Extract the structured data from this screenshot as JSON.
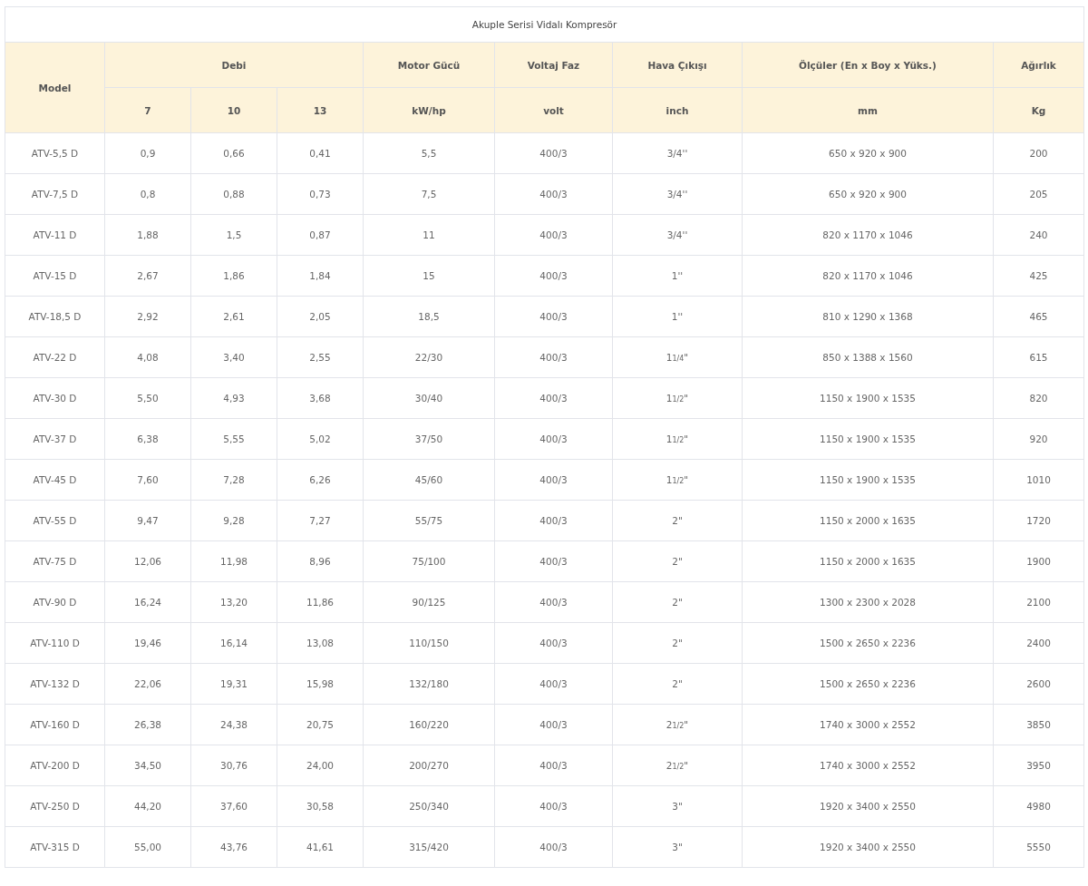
{
  "table": {
    "title": "Akuple Serisi Vidalı Kompresör",
    "header_groups": [
      {
        "label": "Model",
        "kind": "stacked"
      },
      {
        "label": "Debi",
        "kind": "group"
      },
      {
        "label": "Motor Gücü",
        "kind": "column"
      },
      {
        "label": "Voltaj Faz",
        "kind": "column"
      },
      {
        "label": "Hava Çıkışı",
        "kind": "column"
      },
      {
        "label": "Ölçüler (En x Boy x Yüks.)",
        "kind": "column"
      },
      {
        "label": "Ağırlık",
        "kind": "column"
      }
    ],
    "subheaders": [
      "7",
      "10",
      "13",
      "kW/hp",
      "volt",
      "inch",
      "mm",
      "Kg"
    ],
    "rows": [
      [
        "ATV-5,5 D",
        "0,9",
        "0,66",
        "0,41",
        "5,5",
        "400/3",
        "3/4''",
        "650 x 920 x 900",
        "200"
      ],
      [
        "ATV-7,5 D",
        "0,8",
        "0,88",
        "0,73",
        "7,5",
        "400/3",
        "3/4''",
        "650 x 920 x 900",
        "205"
      ],
      [
        "ATV-11 D",
        "1,88",
        "1,5",
        "0,87",
        "11",
        "400/3",
        "3/4''",
        "820 x 1170 x 1046",
        "240"
      ],
      [
        "ATV-15 D",
        "2,67",
        "1,86",
        "1,84",
        "15",
        "400/3",
        "1''",
        "820 x 1170 x 1046",
        "425"
      ],
      [
        "ATV-18,5 D",
        "2,92",
        "2,61",
        "2,05",
        "18,5",
        "400/3",
        "1''",
        "810 x 1290 x 1368",
        "465"
      ],
      [
        "ATV-22 D",
        "4,08",
        "3,40",
        "2,55",
        "22/30",
        "400/3",
        "1$_{1/4}$\"",
        "850 x 1388 x 1560",
        "615"
      ],
      [
        "ATV-30 D",
        "5,50",
        "4,93",
        "3,68",
        "30/40",
        "400/3",
        "1$_{1/2}$\"",
        "1150 x 1900 x 1535",
        "820"
      ],
      [
        "ATV-37 D",
        "6,38",
        "5,55",
        "5,02",
        "37/50",
        "400/3",
        "1$_{1/2}$\"",
        "1150 x 1900 x 1535",
        "920"
      ],
      [
        "ATV-45 D",
        "7,60",
        "7,28",
        "6,26",
        "45/60",
        "400/3",
        "1$_{1/2}$\"",
        "1150 x 1900 x 1535",
        "1010"
      ],
      [
        "ATV-55 D",
        "9,47",
        "9,28",
        "7,27",
        "55/75",
        "400/3",
        "2\"",
        "1150 x 2000 x 1635",
        "1720"
      ],
      [
        "ATV-75 D",
        "12,06",
        "11,98",
        "8,96",
        "75/100",
        "400/3",
        "2\"",
        "1150 x 2000 x 1635",
        "1900"
      ],
      [
        "ATV-90 D",
        "16,24",
        "13,20",
        "11,86",
        "90/125",
        "400/3",
        "2\"",
        "1300 x 2300 x 2028",
        "2100"
      ],
      [
        "ATV-110 D",
        "19,46",
        "16,14",
        "13,08",
        "110/150",
        "400/3",
        "2\"",
        "1500 x 2650 x 2236",
        "2400"
      ],
      [
        "ATV-132 D",
        "22,06",
        "19,31",
        "15,98",
        "132/180",
        "400/3",
        "2\"",
        "1500 x 2650 x 2236",
        "2600"
      ],
      [
        "ATV-160 D",
        "26,38",
        "24,38",
        "20,75",
        "160/220",
        "400/3",
        "2$_{1/2}$\"",
        "1740 x 3000 x 2552",
        "3850"
      ],
      [
        "ATV-200 D",
        "34,50",
        "30,76",
        "24,00",
        "200/270",
        "400/3",
        "2$_{1/2}$\"",
        "1740 x 3000 x 2552",
        "3950"
      ],
      [
        "ATV-250 D",
        "44,20",
        "37,60",
        "30,58",
        "250/340",
        "400/3",
        "3\"",
        "1920 x 3400 x 2550",
        "4980"
      ],
      [
        "ATV-315 D",
        "55,00",
        "43,76",
        "41,61",
        "315/420",
        "400/3",
        "3\"",
        "1920 x 3400 x 2550",
        "5550"
      ]
    ]
  }
}
